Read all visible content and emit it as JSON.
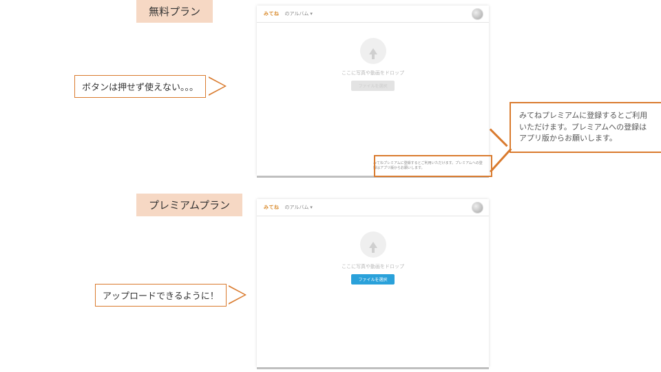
{
  "free": {
    "tag": "無料プラン",
    "logo": "みてね",
    "crumb": "のアルバム ▾",
    "drop_text": "ここに写真や動画をドロップ",
    "button": "ファイルを選択",
    "banner": "みてねプレミアムに登録するとご利用いただけます。プレミアムへの登録はアプリ版からお願いします。",
    "annotation": "ボタンは押せず使えない。。。"
  },
  "premium": {
    "tag": "プレミアムプラン",
    "logo": "みてね",
    "crumb": "のアルバム ▾",
    "drop_text": "ここに写真や動画をドロップ",
    "button": "ファイルを選択",
    "annotation": "アップロードできるように！"
  },
  "big_note": "みてねプレミアムに登録するとご利用いただけます。プレミアムへの登録はアプリ版からお願いします。"
}
